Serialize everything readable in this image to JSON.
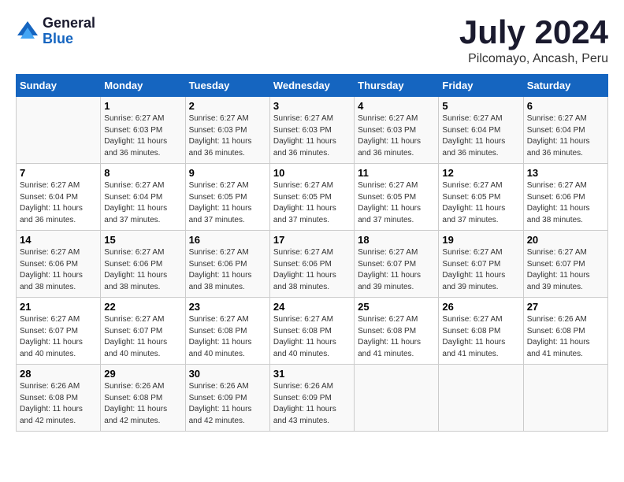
{
  "header": {
    "logo_general": "General",
    "logo_blue": "Blue",
    "month": "July 2024",
    "location": "Pilcomayo, Ancash, Peru"
  },
  "weekdays": [
    "Sunday",
    "Monday",
    "Tuesday",
    "Wednesday",
    "Thursday",
    "Friday",
    "Saturday"
  ],
  "weeks": [
    [
      {
        "day": "",
        "info": ""
      },
      {
        "day": "1",
        "info": "Sunrise: 6:27 AM\nSunset: 6:03 PM\nDaylight: 11 hours\nand 36 minutes."
      },
      {
        "day": "2",
        "info": "Sunrise: 6:27 AM\nSunset: 6:03 PM\nDaylight: 11 hours\nand 36 minutes."
      },
      {
        "day": "3",
        "info": "Sunrise: 6:27 AM\nSunset: 6:03 PM\nDaylight: 11 hours\nand 36 minutes."
      },
      {
        "day": "4",
        "info": "Sunrise: 6:27 AM\nSunset: 6:03 PM\nDaylight: 11 hours\nand 36 minutes."
      },
      {
        "day": "5",
        "info": "Sunrise: 6:27 AM\nSunset: 6:04 PM\nDaylight: 11 hours\nand 36 minutes."
      },
      {
        "day": "6",
        "info": "Sunrise: 6:27 AM\nSunset: 6:04 PM\nDaylight: 11 hours\nand 36 minutes."
      }
    ],
    [
      {
        "day": "7",
        "info": "Sunrise: 6:27 AM\nSunset: 6:04 PM\nDaylight: 11 hours\nand 36 minutes."
      },
      {
        "day": "8",
        "info": "Sunrise: 6:27 AM\nSunset: 6:04 PM\nDaylight: 11 hours\nand 37 minutes."
      },
      {
        "day": "9",
        "info": "Sunrise: 6:27 AM\nSunset: 6:05 PM\nDaylight: 11 hours\nand 37 minutes."
      },
      {
        "day": "10",
        "info": "Sunrise: 6:27 AM\nSunset: 6:05 PM\nDaylight: 11 hours\nand 37 minutes."
      },
      {
        "day": "11",
        "info": "Sunrise: 6:27 AM\nSunset: 6:05 PM\nDaylight: 11 hours\nand 37 minutes."
      },
      {
        "day": "12",
        "info": "Sunrise: 6:27 AM\nSunset: 6:05 PM\nDaylight: 11 hours\nand 37 minutes."
      },
      {
        "day": "13",
        "info": "Sunrise: 6:27 AM\nSunset: 6:06 PM\nDaylight: 11 hours\nand 38 minutes."
      }
    ],
    [
      {
        "day": "14",
        "info": "Sunrise: 6:27 AM\nSunset: 6:06 PM\nDaylight: 11 hours\nand 38 minutes."
      },
      {
        "day": "15",
        "info": "Sunrise: 6:27 AM\nSunset: 6:06 PM\nDaylight: 11 hours\nand 38 minutes."
      },
      {
        "day": "16",
        "info": "Sunrise: 6:27 AM\nSunset: 6:06 PM\nDaylight: 11 hours\nand 38 minutes."
      },
      {
        "day": "17",
        "info": "Sunrise: 6:27 AM\nSunset: 6:06 PM\nDaylight: 11 hours\nand 38 minutes."
      },
      {
        "day": "18",
        "info": "Sunrise: 6:27 AM\nSunset: 6:07 PM\nDaylight: 11 hours\nand 39 minutes."
      },
      {
        "day": "19",
        "info": "Sunrise: 6:27 AM\nSunset: 6:07 PM\nDaylight: 11 hours\nand 39 minutes."
      },
      {
        "day": "20",
        "info": "Sunrise: 6:27 AM\nSunset: 6:07 PM\nDaylight: 11 hours\nand 39 minutes."
      }
    ],
    [
      {
        "day": "21",
        "info": "Sunrise: 6:27 AM\nSunset: 6:07 PM\nDaylight: 11 hours\nand 40 minutes."
      },
      {
        "day": "22",
        "info": "Sunrise: 6:27 AM\nSunset: 6:07 PM\nDaylight: 11 hours\nand 40 minutes."
      },
      {
        "day": "23",
        "info": "Sunrise: 6:27 AM\nSunset: 6:08 PM\nDaylight: 11 hours\nand 40 minutes."
      },
      {
        "day": "24",
        "info": "Sunrise: 6:27 AM\nSunset: 6:08 PM\nDaylight: 11 hours\nand 40 minutes."
      },
      {
        "day": "25",
        "info": "Sunrise: 6:27 AM\nSunset: 6:08 PM\nDaylight: 11 hours\nand 41 minutes."
      },
      {
        "day": "26",
        "info": "Sunrise: 6:27 AM\nSunset: 6:08 PM\nDaylight: 11 hours\nand 41 minutes."
      },
      {
        "day": "27",
        "info": "Sunrise: 6:26 AM\nSunset: 6:08 PM\nDaylight: 11 hours\nand 41 minutes."
      }
    ],
    [
      {
        "day": "28",
        "info": "Sunrise: 6:26 AM\nSunset: 6:08 PM\nDaylight: 11 hours\nand 42 minutes."
      },
      {
        "day": "29",
        "info": "Sunrise: 6:26 AM\nSunset: 6:08 PM\nDaylight: 11 hours\nand 42 minutes."
      },
      {
        "day": "30",
        "info": "Sunrise: 6:26 AM\nSunset: 6:09 PM\nDaylight: 11 hours\nand 42 minutes."
      },
      {
        "day": "31",
        "info": "Sunrise: 6:26 AM\nSunset: 6:09 PM\nDaylight: 11 hours\nand 43 minutes."
      },
      {
        "day": "",
        "info": ""
      },
      {
        "day": "",
        "info": ""
      },
      {
        "day": "",
        "info": ""
      }
    ]
  ]
}
